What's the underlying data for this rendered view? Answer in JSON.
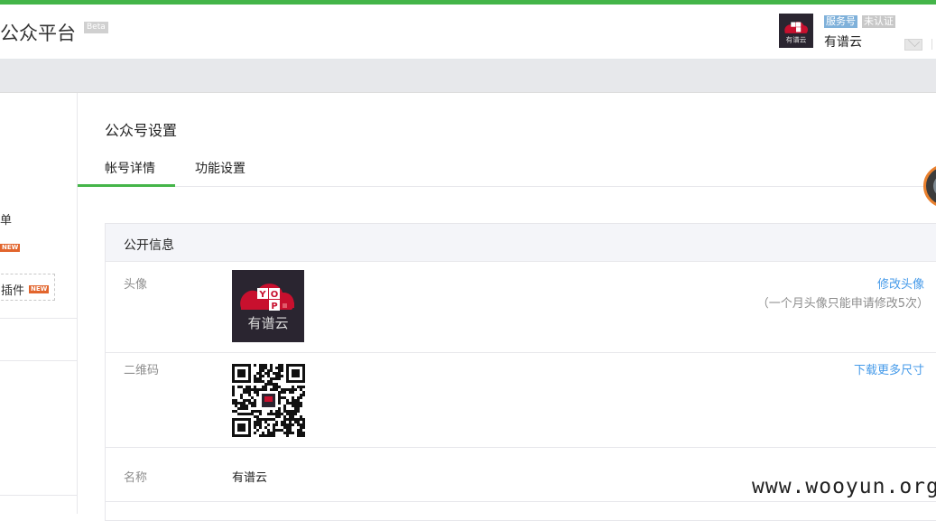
{
  "header": {
    "brand_title": "公众平台",
    "beta_badge": "Beta",
    "account_type_tag": "服务号",
    "verify_tag": "未认证",
    "account_name": "有谱云"
  },
  "sidebar": {
    "partial_item_text": "单",
    "new_badge_1": "NEW",
    "plugin_label": "插件",
    "new_badge_2": "NEW"
  },
  "main": {
    "page_title": "公众号设置",
    "tabs": [
      {
        "label": "帐号详情",
        "active": true
      },
      {
        "label": "功能设置",
        "active": false
      }
    ],
    "panel": {
      "title": "公开信息",
      "rows": {
        "avatar": {
          "label": "头像",
          "action": "修改头像",
          "note": "（一个月头像只能申请修改5次）",
          "logo_text": "有谱云",
          "logo_letters": [
            "Y",
            "O",
            "P"
          ]
        },
        "qrcode": {
          "label": "二维码",
          "action": "下载更多尺寸"
        },
        "name": {
          "label": "名称",
          "value": "有谱云"
        }
      }
    }
  },
  "watermark": "www.wooyun.org",
  "colors": {
    "accent_green": "#44b549",
    "link_blue": "#459ae9",
    "logo_red": "#c8102e",
    "new_badge": "#e2652d"
  }
}
